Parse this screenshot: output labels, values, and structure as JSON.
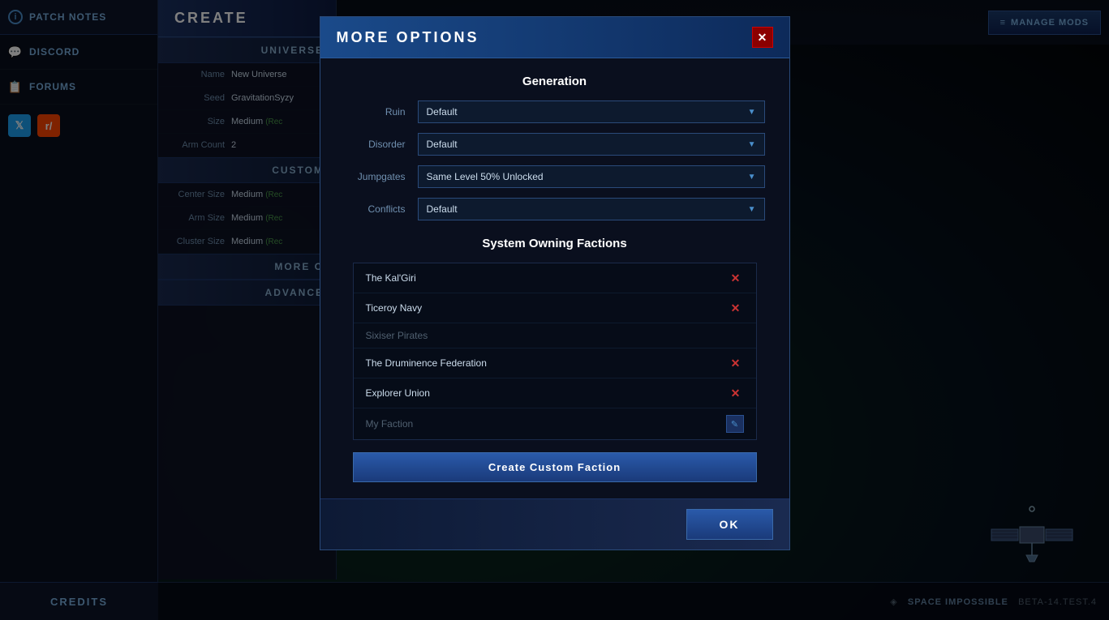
{
  "sidebar": {
    "patch_notes_label": "PATCH NOTES",
    "discord_label": "DISCORD",
    "forums_label": "FORUMS",
    "credits_label": "CREDITS"
  },
  "top_bar": {
    "manage_mods_label": "MANAGE MODS"
  },
  "create_panel": {
    "title": "CREATE",
    "universe_section": "UNIVERSE",
    "custom_section": "CUSTOM",
    "more_section": "MORE O",
    "advanced_section": "ADVANCE",
    "fields": {
      "name_label": "Name",
      "name_value": "New Universe",
      "seed_label": "Seed",
      "seed_value": "GravitationSyzy",
      "size_label": "Size",
      "size_value": "Medium",
      "size_rec": "(Rec",
      "arm_count_label": "Arm Count",
      "arm_count_value": "2",
      "center_size_label": "Center Size",
      "center_size_value": "Medium",
      "center_size_rec": "(Rec",
      "arm_size_label": "Arm Size",
      "arm_size_value": "Medium",
      "arm_size_rec": "(Rec",
      "cluster_size_label": "Cluster Size",
      "cluster_size_value": "Medium",
      "cluster_size_rec": "(Rec"
    }
  },
  "modal": {
    "title": "MORE OPTIONS",
    "close_label": "✕",
    "generation_section": "Generation",
    "ruin_label": "Ruin",
    "ruin_value": "Default",
    "disorder_label": "Disorder",
    "disorder_value": "Default",
    "jumpgates_label": "Jumpgates",
    "jumpgates_value": "Same Level 50% Unlocked",
    "conflicts_label": "Conflicts",
    "conflicts_value": "Default",
    "system_owning_section": "System Owning Factions",
    "factions": [
      {
        "name": "The Kal'Giri",
        "enabled": true
      },
      {
        "name": "Ticeroy Navy",
        "enabled": true
      },
      {
        "name": "Sixiser Pirates",
        "enabled": false
      },
      {
        "name": "The Druminence Federation",
        "enabled": true
      },
      {
        "name": "Explorer Union",
        "enabled": true
      },
      {
        "name": "My Faction",
        "enabled": false,
        "editable": true
      }
    ],
    "create_faction_btn": "Create Custom Faction",
    "ok_btn": "OK"
  },
  "version": {
    "prefix": "◈",
    "game_name": "SPACE IMPOSSIBLE",
    "version_text": "BETA-14.TEST.4"
  }
}
